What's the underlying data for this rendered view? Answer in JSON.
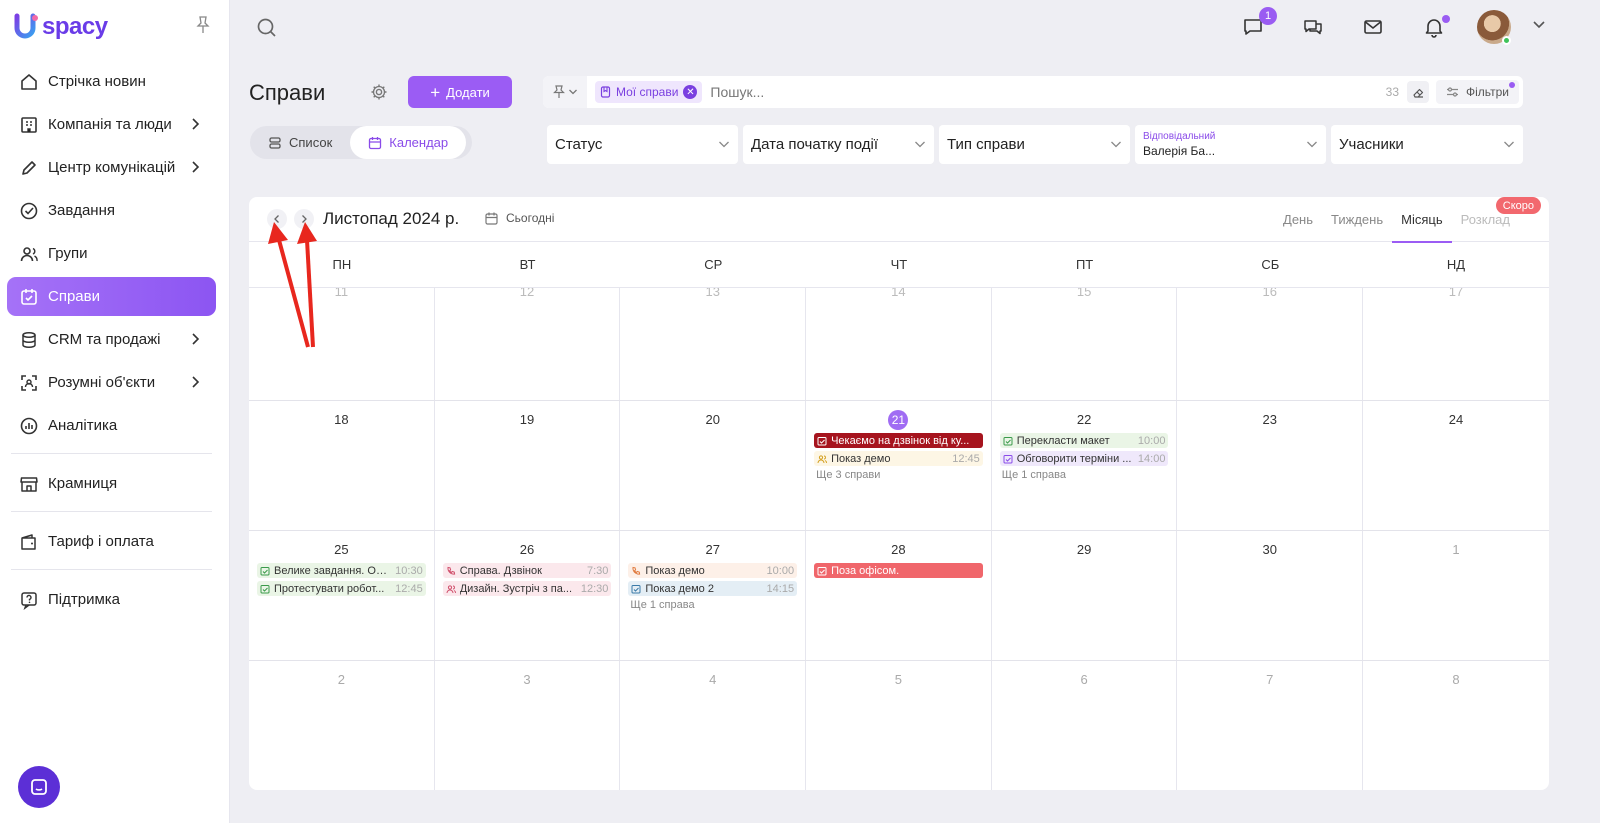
{
  "brand": {
    "name": "spacy"
  },
  "sidebar": {
    "items": [
      {
        "label": "Стрічка новин",
        "icon": "home-icon"
      },
      {
        "label": "Компанія та люди",
        "icon": "building-icon",
        "has_children": true
      },
      {
        "label": "Центр комунікацій",
        "icon": "edit-icon",
        "has_children": true
      },
      {
        "label": "Завдання",
        "icon": "check-circle-icon"
      },
      {
        "label": "Групи",
        "icon": "users-icon"
      },
      {
        "label": "Справи",
        "icon": "calendar-check-icon",
        "active": true
      },
      {
        "label": "CRM та продажі",
        "icon": "database-icon",
        "has_children": true
      },
      {
        "label": "Розумні об'єкти",
        "icon": "scan-icon",
        "has_children": true
      },
      {
        "label": "Аналітика",
        "icon": "chart-circle-icon"
      }
    ],
    "store": {
      "label": "Крамниця",
      "icon": "store-icon"
    },
    "billing": {
      "label": "Тариф і оплата",
      "icon": "wallet-icon"
    },
    "support": {
      "label": "Підтримка",
      "icon": "help-icon"
    }
  },
  "topbar": {
    "chat_badge": "1"
  },
  "header": {
    "title": "Справи",
    "add_label": "Додати",
    "view_list": "Список",
    "view_calendar": "Календар"
  },
  "filterbar": {
    "chip": "Мої справи",
    "search_placeholder": "Пошук...",
    "count": "33",
    "filters_label": "Фільтри"
  },
  "dropdowns": {
    "status": "Статус",
    "start_date": "Дата початку події",
    "type": "Тип справи",
    "responsible_label": "Відповідальний",
    "responsible_value": "Валерія Ба...",
    "participants": "Учасники"
  },
  "calendar": {
    "month_title": "Листопад 2024 р.",
    "today_label": "Сьогодні",
    "views": [
      "День",
      "Тиждень",
      "Місяць",
      "Розклад"
    ],
    "soon_badge": "Скоро",
    "weekdays": [
      "ПН",
      "ВТ",
      "СР",
      "ЧТ",
      "ПТ",
      "СБ",
      "НД"
    ],
    "weeks": [
      {
        "days": [
          {
            "n": "11"
          },
          {
            "n": "12"
          },
          {
            "n": "13"
          },
          {
            "n": "14"
          },
          {
            "n": "15"
          },
          {
            "n": "16"
          },
          {
            "n": "17"
          }
        ]
      },
      {
        "days": [
          {
            "n": "18"
          },
          {
            "n": "19"
          },
          {
            "n": "20"
          },
          {
            "n": "21",
            "today": true,
            "events": [
              {
                "title": "Чекаємо на дзвінок від ку...",
                "time": "",
                "style": "red",
                "icon": "task-icon"
              },
              {
                "title": "Показ демо",
                "time": "12:45",
                "style": "yellow",
                "icon": "people-icon"
              }
            ],
            "more": "Ще 3 справи"
          },
          {
            "n": "22",
            "events": [
              {
                "title": "Перекласти макет",
                "time": "10:00",
                "style": "green",
                "icon": "task-icon"
              },
              {
                "title": "Обговорити терміни ...",
                "time": "14:00",
                "style": "purple",
                "icon": "task-icon"
              }
            ],
            "more": "Ще 1 справа"
          },
          {
            "n": "23"
          },
          {
            "n": "24"
          }
        ]
      },
      {
        "days": [
          {
            "n": "25",
            "events": [
              {
                "title": "Велике завдання. Об...",
                "time": "10:30",
                "style": "green",
                "icon": "task-icon"
              },
              {
                "title": "Протестувати робот...",
                "time": "12:45",
                "style": "green",
                "icon": "task-icon"
              }
            ]
          },
          {
            "n": "26",
            "events": [
              {
                "title": "Справа. Дзвінок",
                "time": "7:30",
                "style": "pink",
                "icon": "phone-icon"
              },
              {
                "title": "Дизайн. Зустріч з па...",
                "time": "12:30",
                "style": "pink",
                "icon": "people-icon"
              }
            ]
          },
          {
            "n": "27",
            "events": [
              {
                "title": "Показ демо",
                "time": "10:00",
                "style": "peach",
                "icon": "phone-icon"
              },
              {
                "title": "Показ демо 2",
                "time": "14:15",
                "style": "blue",
                "icon": "task-icon"
              }
            ],
            "more": "Ще 1 справа"
          },
          {
            "n": "28",
            "events": [
              {
                "title": "Поза офісом.",
                "time": "",
                "style": "coral",
                "icon": "task-icon"
              }
            ]
          },
          {
            "n": "29"
          },
          {
            "n": "30"
          },
          {
            "n": "1",
            "muted": true
          }
        ]
      },
      {
        "days": [
          {
            "n": "2",
            "muted": true
          },
          {
            "n": "3",
            "muted": true
          },
          {
            "n": "4",
            "muted": true
          },
          {
            "n": "5",
            "muted": true
          },
          {
            "n": "6",
            "muted": true
          },
          {
            "n": "7",
            "muted": true
          },
          {
            "n": "8",
            "muted": true
          }
        ]
      }
    ]
  },
  "colors": {
    "accent": "#9b5cf4",
    "today": "#a06cf3",
    "annotation_arrow": "#e8271e"
  }
}
